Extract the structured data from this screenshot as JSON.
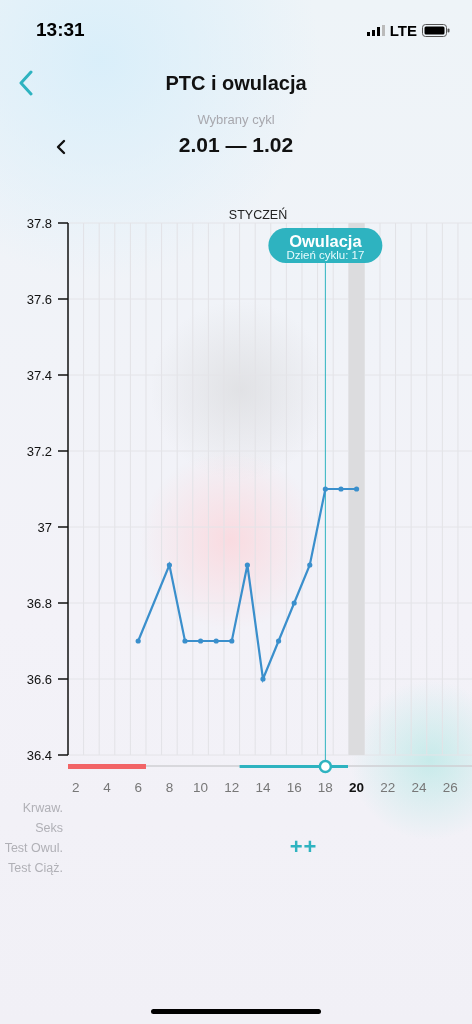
{
  "status_bar": {
    "time": "13:31",
    "network": "LTE"
  },
  "header": {
    "title": "PTC i owulacja"
  },
  "cycle": {
    "label": "Wybrany cykl",
    "range": "2.01 — 1.02"
  },
  "chart": {
    "month": "STYCZEŃ",
    "badge": {
      "title": "Owulacja",
      "subtitle": "Dzień cyklu: 17"
    },
    "chart_data": {
      "type": "line",
      "grid": true,
      "xlim": [
        1.5,
        27.4
      ],
      "ylim": [
        36.4,
        37.8
      ],
      "yticks": [
        {
          "value": 36.4,
          "label": "36.4"
        },
        {
          "value": 36.6,
          "label": "36.6"
        },
        {
          "value": 36.8,
          "label": "36.8"
        },
        {
          "value": 37,
          "label": "37"
        },
        {
          "value": 37.2,
          "label": "37.2"
        },
        {
          "value": 37.4,
          "label": "37.4"
        },
        {
          "value": 37.6,
          "label": "37.6"
        },
        {
          "value": 37.8,
          "label": "37.8"
        }
      ],
      "xticks": [
        2,
        4,
        6,
        8,
        10,
        12,
        14,
        16,
        18,
        20,
        22,
        24,
        26
      ],
      "x": [
        6,
        8,
        9,
        10,
        11,
        12,
        13,
        14,
        15,
        16,
        17,
        18,
        19,
        20
      ],
      "series": [
        {
          "color": "#3a8fcc",
          "values": [
            36.7,
            36.9,
            36.7,
            36.7,
            36.7,
            36.7,
            36.9,
            36.6,
            36.7,
            36.8,
            36.9,
            37.1,
            37.1,
            37.1
          ]
        }
      ],
      "ref_lines": [
        {
          "axis": "x",
          "value": 18,
          "color": "#2eb3c0"
        }
      ],
      "bands": [
        {
          "axis": "x",
          "from": 19.5,
          "to": 20.5,
          "color": "#dcdcde"
        }
      ]
    },
    "track_bars": [
      {
        "kind": "period",
        "color": "#f26466",
        "level": 0.193
      },
      {
        "kind": "fertile",
        "color": "#2eb3c0"
      }
    ]
  },
  "rows": [
    {
      "label": "Krwaw."
    },
    {
      "label": "Seks"
    },
    {
      "label": "Test Owul.",
      "marker": "++"
    },
    {
      "label": "Test Ciąż."
    }
  ]
}
